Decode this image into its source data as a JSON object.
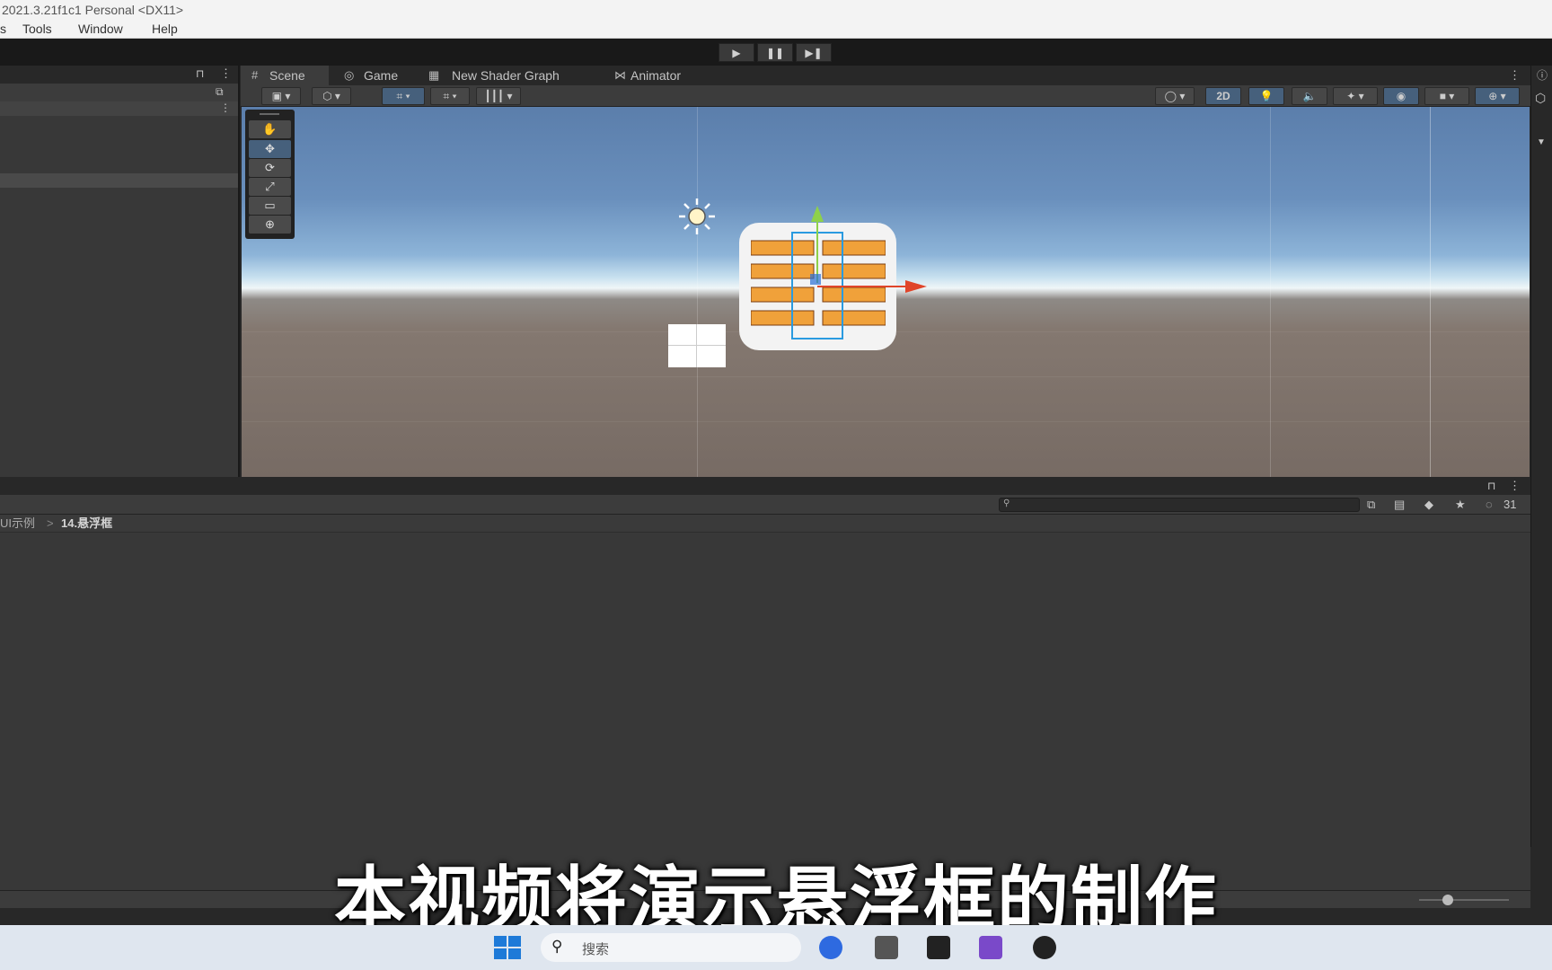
{
  "title_bar": {
    "text": "2021.3.21f1c1 Personal <DX11>"
  },
  "menu": {
    "items": [
      "s",
      "Tools",
      "Window",
      "Help"
    ]
  },
  "play_controls": {
    "play": "▶",
    "pause": "❚❚",
    "step": "▶❚"
  },
  "scene_tabs": [
    {
      "label": "Scene",
      "icon": "#"
    },
    {
      "label": "Game",
      "icon": "◎"
    },
    {
      "label": "New Shader Graph",
      "icon": "▦"
    },
    {
      "label": "Animator",
      "icon": "⋈"
    }
  ],
  "scene_toolbar": {
    "mode_2d": "2D"
  },
  "tool_palette": [
    "✋",
    "✥",
    "⟳",
    "⤢",
    "▭",
    "⊕"
  ],
  "project": {
    "breadcrumb_parent": "UI示例",
    "breadcrumb_sep": ">",
    "breadcrumb_current": "14.悬浮框",
    "search_placeholder": "",
    "hidden_count": "31"
  },
  "taskbar": {
    "search_placeholder": "搜索"
  },
  "caption": "本视频将演示悬浮框的制作",
  "colors": {
    "accent": "#46607c",
    "panel": "#383838",
    "dark": "#282828"
  }
}
